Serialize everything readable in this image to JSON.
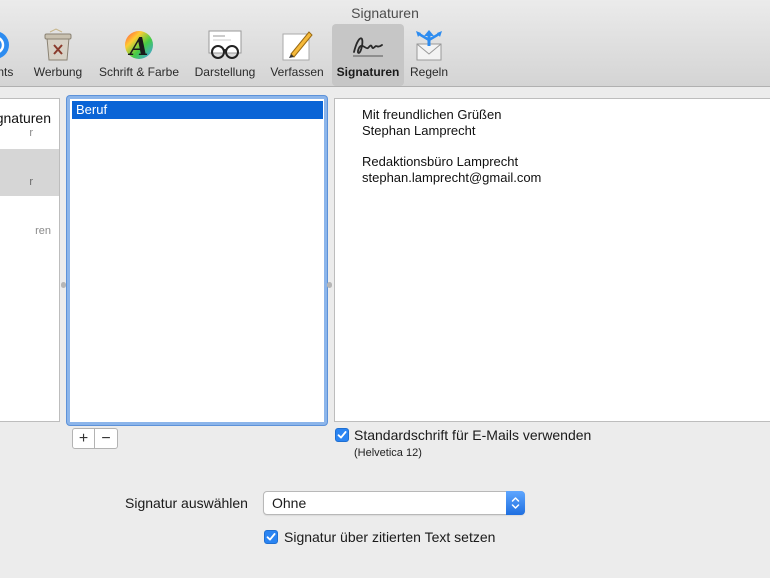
{
  "window": {
    "title": "Signaturen"
  },
  "toolbar": {
    "items": [
      {
        "label": "unts",
        "icon": "accounts-icon"
      },
      {
        "label": "Werbung",
        "icon": "junk-mail-trash-icon"
      },
      {
        "label": "Schrift & Farbe",
        "icon": "fonts-colors-icon"
      },
      {
        "label": "Darstellung",
        "icon": "viewing-glasses-icon"
      },
      {
        "label": "Verfassen",
        "icon": "composing-pencil-icon"
      },
      {
        "label": "Signaturen",
        "icon": "signature-icon",
        "selected": true
      },
      {
        "label": "Regeln",
        "icon": "rules-icon"
      }
    ]
  },
  "accounts": {
    "all_title": "gnaturen",
    "all_subtitle": "r",
    "selected_subtitle": "r",
    "third_subtitle": "ren"
  },
  "signatures": {
    "items": [
      {
        "label": "Beruf",
        "selected": true
      }
    ]
  },
  "editor": {
    "lines": [
      "Mit freundlichen Grüßen",
      "Stephan Lamprecht",
      "",
      "Redaktionsbüro Lamprecht",
      "stephan.lamprecht@gmail.com"
    ]
  },
  "buttons": {
    "add": "+",
    "remove": "−"
  },
  "default_font": {
    "checkbox_label": "Standardschrift für E-Mails verwenden",
    "checked": true,
    "note": "(Helvetica 12)"
  },
  "choose_signature": {
    "label": "Signatur auswählen",
    "value": "Ohne"
  },
  "above_quote": {
    "checkbox_label": "Signatur über zitierten Text setzen",
    "checked": true
  },
  "colors": {
    "selection": "#0a64d6",
    "checkbox": "#2a84f2",
    "focus_ring": "#8cb5ea"
  }
}
